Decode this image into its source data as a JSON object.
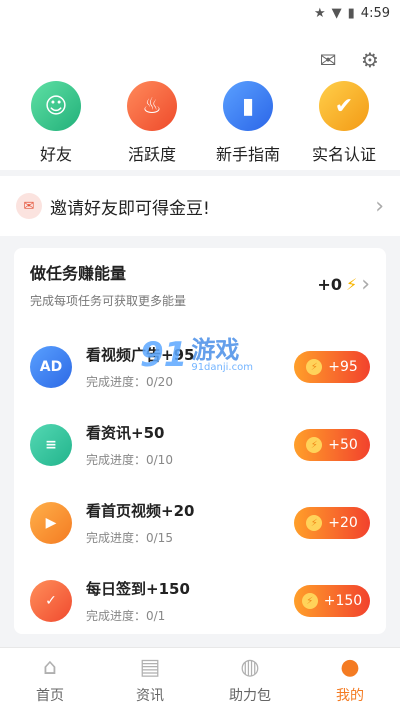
{
  "status_bar": {
    "time": "4:59"
  },
  "header": {
    "icons": [
      "mail-icon",
      "settings-icon"
    ],
    "quick_actions": [
      {
        "label": "好友",
        "icon": "friend-icon",
        "color": "#22b07a"
      },
      {
        "label": "活跃度",
        "icon": "fire-icon",
        "color": "#ee4a2b"
      },
      {
        "label": "新手指南",
        "icon": "book-icon",
        "color": "#2b66e8"
      },
      {
        "label": "实名认证",
        "icon": "verified-user-icon",
        "color": "#f39a15"
      }
    ]
  },
  "invite": {
    "text": "邀请好友即可得金豆!"
  },
  "tasks": {
    "title": "做任务赚能量",
    "subtitle": "完成每项任务可获取更多能量",
    "energy": "+0",
    "items": [
      {
        "name": "看视频广告+95",
        "progress": "完成进度：0/20",
        "reward": "+95",
        "icon_text": "AD"
      },
      {
        "name": "看资讯+50",
        "progress": "完成进度：0/10",
        "reward": "+50",
        "icon_text": "≡"
      },
      {
        "name": "看首页视频+20",
        "progress": "完成进度：0/15",
        "reward": "+20",
        "icon_text": "▶"
      },
      {
        "name": "每日签到+150",
        "progress": "完成进度：0/1",
        "reward": "+150",
        "icon_text": "✓"
      }
    ]
  },
  "watermark": {
    "brand": "91",
    "game": "游戏",
    "url": "91danji.com"
  },
  "tabbar": {
    "active": "我的",
    "items": [
      {
        "label": "首页",
        "icon": "home-icon"
      },
      {
        "label": "资讯",
        "icon": "news-icon"
      },
      {
        "label": "助力包",
        "icon": "moneybag-icon"
      },
      {
        "label": "我的",
        "icon": "profile-icon"
      }
    ]
  }
}
